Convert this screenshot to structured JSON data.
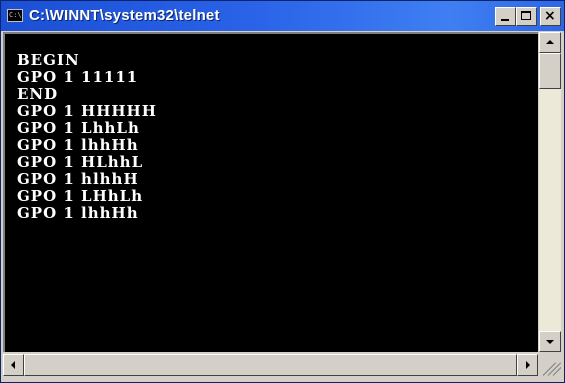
{
  "window": {
    "title": "C:\\WINNT\\system32\\telnet",
    "icon_label": "C:\\",
    "icon": "console-icon",
    "controls": {
      "minimize_icon": "minimize-icon",
      "maximize_icon": "maximize-icon",
      "close_glyph": "×"
    }
  },
  "console": {
    "background": "#000000",
    "foreground": "#ffffff",
    "lines": [
      "BEGIN",
      "GPO 1 11111",
      "END",
      "GPO 1 HHHHH",
      "GPO 1 LhhLh",
      "GPO 1 lhhHh",
      "GPO 1 HLhhL",
      "GPO 1 hlhhH",
      "GPO 1 LHhLh",
      "GPO 1 lhhHh"
    ]
  },
  "colors": {
    "titlebar": "#2a63e8",
    "chrome": "#d4d0c8"
  }
}
